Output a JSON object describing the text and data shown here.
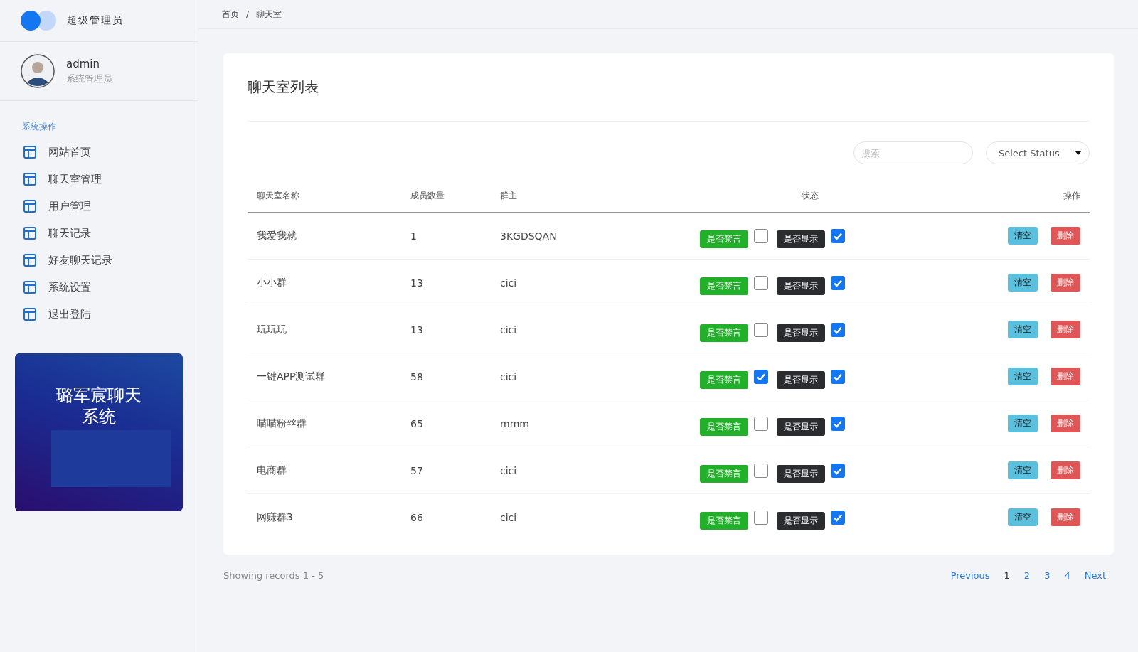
{
  "brand": {
    "title": "超级管理员"
  },
  "user": {
    "name": "admin",
    "role": "系统管理员"
  },
  "sidebar": {
    "heading": "系统操作",
    "items": [
      {
        "label": "网站首页",
        "selected": false
      },
      {
        "label": "聊天室管理",
        "selected": false
      },
      {
        "label": "用户管理",
        "selected": false
      },
      {
        "label": "聊天记录",
        "selected": false
      },
      {
        "label": "好友聊天记录",
        "selected": false
      },
      {
        "label": "系统设置",
        "selected": false
      },
      {
        "label": "退出登陆",
        "selected": false
      }
    ],
    "promo": "璐军宸聊天系统"
  },
  "breadcrumb": [
    "首页",
    "/",
    "聊天室"
  ],
  "card": {
    "title": "聊天室列表",
    "search": {
      "placeholder": "搜索"
    },
    "status_select": "Select Status",
    "columns": [
      "聊天室名称",
      "成员数量",
      "群主",
      "状态",
      "操作"
    ],
    "rows": [
      {
        "name": "我爱我就",
        "members": "1",
        "owner": "3KGDSQAN",
        "mute_label": "是否禁言",
        "muted": false,
        "show_label": "是否显示",
        "shown": true,
        "clear": "清空",
        "delete": "删除"
      },
      {
        "name": "小小群",
        "members": "13",
        "owner": "cici",
        "mute_label": "是否禁言",
        "muted": false,
        "show_label": "是否显示",
        "shown": true,
        "clear": "清空",
        "delete": "删除"
      },
      {
        "name": "玩玩玩",
        "members": "13",
        "owner": "cici",
        "mute_label": "是否禁言",
        "muted": false,
        "show_label": "是否显示",
        "shown": true,
        "clear": "清空",
        "delete": "删除"
      },
      {
        "name": "一键APP测试群",
        "members": "58",
        "owner": "cici",
        "mute_label": "是否禁言",
        "muted": true,
        "show_label": "是否显示",
        "shown": true,
        "clear": "清空",
        "delete": "删除"
      },
      {
        "name": "喵喵粉丝群",
        "members": "65",
        "owner": "mmm",
        "mute_label": "是否禁言",
        "muted": false,
        "show_label": "是否显示",
        "shown": true,
        "clear": "清空",
        "delete": "删除"
      },
      {
        "name": "电商群",
        "members": "57",
        "owner": "cici",
        "mute_label": "是否禁言",
        "muted": false,
        "show_label": "是否显示",
        "shown": true,
        "clear": "清空",
        "delete": "删除"
      },
      {
        "name": "网赚群3",
        "members": "66",
        "owner": "cici",
        "mute_label": "是否禁言",
        "muted": false,
        "show_label": "是否显示",
        "shown": true,
        "clear": "清空",
        "delete": "删除"
      }
    ]
  },
  "footer": {
    "records": "Showing records 1 - 5",
    "pagination": [
      {
        "label": "Previous",
        "selected": false
      },
      {
        "label": "1",
        "selected": true
      },
      {
        "label": "2",
        "selected": false
      },
      {
        "label": "3",
        "selected": false
      },
      {
        "label": "4",
        "selected": false
      },
      {
        "label": "Next",
        "selected": false
      }
    ]
  }
}
